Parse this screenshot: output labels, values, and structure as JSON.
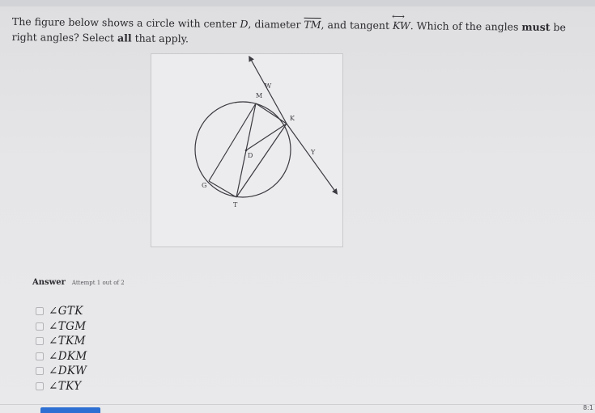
{
  "question": {
    "part1": "The figure below shows a circle with center ",
    "center": "D",
    "part2": ", diameter ",
    "diameter": "TM",
    "part3": ", and tangent ",
    "tangent": "KW",
    "part4": ". Which of the angles ",
    "must": "must",
    "part5": " be right angles? Select ",
    "all": "all",
    "part6": " that apply."
  },
  "figure": {
    "labels": {
      "W": "W",
      "M": "M",
      "K": "K",
      "D": "D",
      "Y": "Y",
      "G": "G",
      "T": "T"
    }
  },
  "answer": {
    "label": "Answer",
    "attempt": "Attempt 1 out of 2"
  },
  "options": [
    "∠GTK",
    "∠TGM",
    "∠TKM",
    "∠DKM",
    "∠DKW",
    "∠TKY"
  ],
  "clock": "8:1",
  "colors": {
    "accent": "#2d6fd2",
    "figure_background": "#ececee",
    "line_color": "#3a3a40"
  }
}
